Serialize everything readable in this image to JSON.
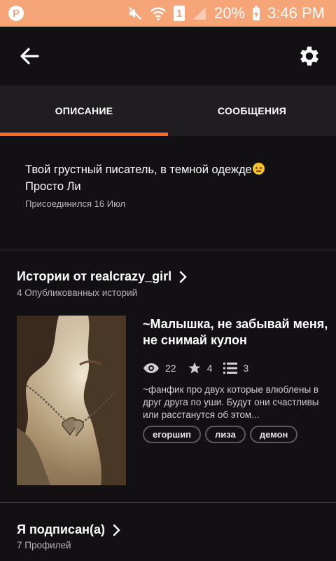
{
  "status_bar": {
    "battery": "20%",
    "time": "3:46 PM",
    "sim_label": "1"
  },
  "tabs": [
    {
      "label": "ОПИСАНИЕ",
      "active": true
    },
    {
      "label": "СООБЩЕНИЯ",
      "active": false
    }
  ],
  "profile": {
    "bio_line1": "Твой грустный писатель, в темной одежде",
    "bio_line2": "Просто Ли",
    "joined": "Присоединился 16 Июл"
  },
  "stories_section": {
    "title": "Истории от realcrazy_girl",
    "subtitle": "4 Опубликованных историй"
  },
  "story": {
    "title": "~Малышка, не забывай меня, не снимай кулон",
    "views": "22",
    "votes": "4",
    "parts": "3",
    "description": "~фанфик про двух которые влюблены в друг друга по уши. Будут они счастливы или расстанутся об этом...",
    "tags": [
      "егоршип",
      "лиза",
      "демон"
    ]
  },
  "following_section": {
    "title": "Я подписан(а)",
    "subtitle": "7 Профилей"
  },
  "colors": {
    "status_bar": "#f5a578",
    "accent": "#ff6a1e",
    "background": "#121013",
    "tab_bar": "#1f1d20"
  }
}
